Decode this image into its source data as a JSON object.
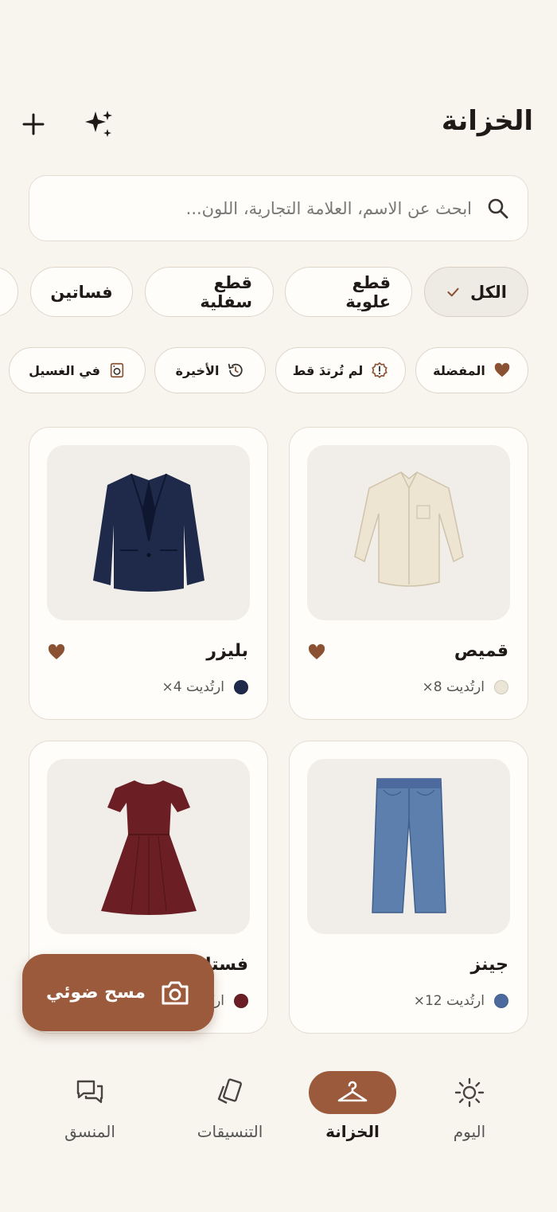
{
  "header": {
    "title": "الخزانة",
    "add_icon": "plus-icon",
    "ai_icon": "sparkles-icon"
  },
  "search": {
    "placeholder": "ابحث عن الاسم، العلامة التجارية، اللون...",
    "icon": "search-icon"
  },
  "categories": [
    {
      "label": "الكل",
      "active": true,
      "icon": "check-icon"
    },
    {
      "label": "قطع علوية",
      "active": false
    },
    {
      "label": "قطع سفلية",
      "active": false
    },
    {
      "label": "فساتين",
      "active": false
    }
  ],
  "filters": [
    {
      "label": "المفضلة",
      "icon": "heart-icon"
    },
    {
      "label": "لم تُرتدَ قط",
      "icon": "alert-badge-icon"
    },
    {
      "label": "الأخيرة",
      "icon": "history-icon"
    },
    {
      "label": "في الغسيل",
      "icon": "washing-machine-icon"
    }
  ],
  "items": [
    {
      "name": "قميص",
      "worn": "ارتُديت 8×",
      "color": "#ebe5d5",
      "favorite": true
    },
    {
      "name": "بليزر",
      "worn": "ارتُديت 4×",
      "color": "#1f2a4a",
      "favorite": true
    },
    {
      "name": "جينز",
      "worn": "ارتُديت 12×",
      "color": "#4d6a9e",
      "favorite": false
    },
    {
      "name": "فستان",
      "worn": "ارتُديت",
      "color": "#6b1f25",
      "favorite": false
    }
  ],
  "fab": {
    "label": "مسح ضوئي",
    "icon": "camera-icon"
  },
  "nav": [
    {
      "label": "اليوم",
      "icon": "sun-icon",
      "active": false
    },
    {
      "label": "الخزانة",
      "icon": "hanger-icon",
      "active": true
    },
    {
      "label": "التنسيقات",
      "icon": "cards-icon",
      "active": false
    },
    {
      "label": "المنسق",
      "icon": "chat-icon",
      "active": false
    }
  ],
  "colors": {
    "accent": "#9c5a3c",
    "background": "#f8f5ef",
    "heart": "#8a5233"
  }
}
